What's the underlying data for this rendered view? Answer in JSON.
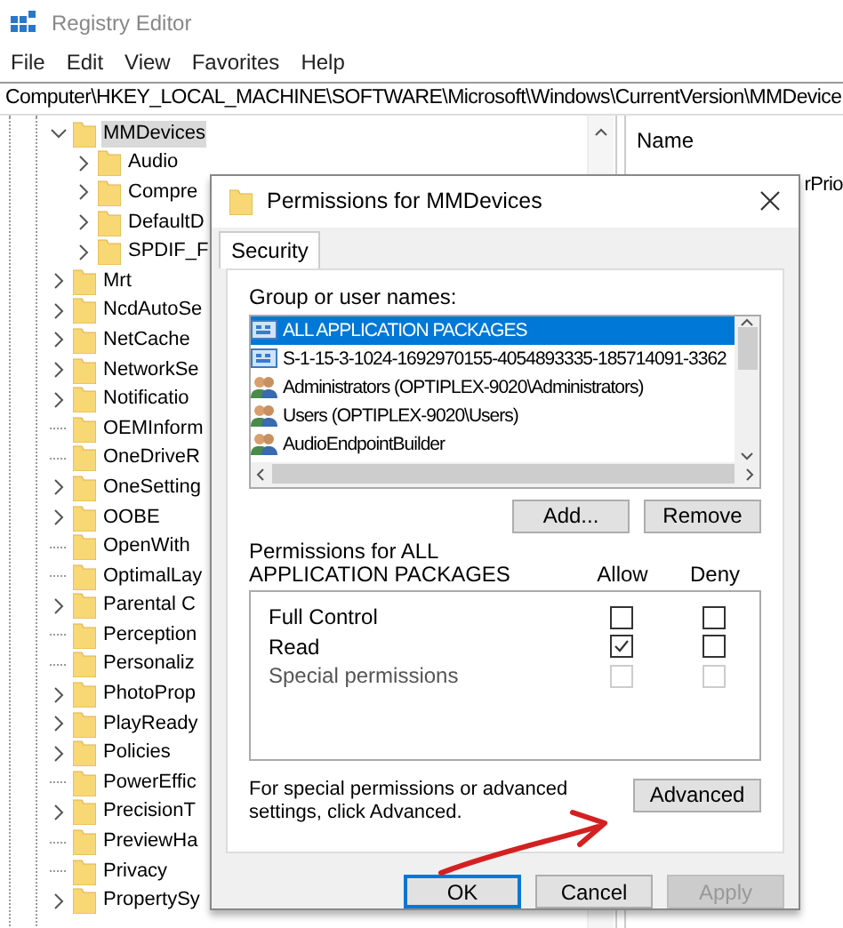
{
  "window": {
    "title": "Registry Editor"
  },
  "menu": [
    "File",
    "Edit",
    "View",
    "Favorites",
    "Help"
  ],
  "address": "Computer\\HKEY_LOCAL_MACHINE\\SOFTWARE\\Microsoft\\Windows\\CurrentVersion\\MMDevice",
  "tree": [
    {
      "label": "MMDevices",
      "expandable": true,
      "expanded": true,
      "selected": true,
      "children": [
        {
          "label": "Audio",
          "expandable": true,
          "expanded": false,
          "selected": false
        },
        {
          "label": "Compre",
          "expandable": true,
          "expanded": false,
          "selected": false
        },
        {
          "label": "DefaultD",
          "expandable": true,
          "expanded": false,
          "selected": false
        },
        {
          "label": "SPDIF_F",
          "expandable": true,
          "expanded": false,
          "selected": false
        }
      ]
    },
    {
      "label": "Mrt",
      "expandable": true,
      "expanded": false,
      "selected": false
    },
    {
      "label": "NcdAutoSe",
      "expandable": true,
      "expanded": false,
      "selected": false
    },
    {
      "label": "NetCache",
      "expandable": true,
      "expanded": false,
      "selected": false
    },
    {
      "label": "NetworkSe",
      "expandable": true,
      "expanded": false,
      "selected": false
    },
    {
      "label": "Notificatio",
      "expandable": true,
      "expanded": false,
      "selected": false
    },
    {
      "label": "OEMInform",
      "expandable": false,
      "selected": false
    },
    {
      "label": "OneDriveR",
      "expandable": false,
      "selected": false
    },
    {
      "label": "OneSetting",
      "expandable": true,
      "expanded": false,
      "selected": false
    },
    {
      "label": "OOBE",
      "expandable": true,
      "expanded": false,
      "selected": false
    },
    {
      "label": "OpenWith",
      "expandable": false,
      "selected": false
    },
    {
      "label": "OptimalLay",
      "expandable": false,
      "selected": false
    },
    {
      "label": "Parental C",
      "expandable": true,
      "expanded": false,
      "selected": false
    },
    {
      "label": "Perception",
      "expandable": false,
      "selected": false
    },
    {
      "label": "Personaliz",
      "expandable": false,
      "selected": false
    },
    {
      "label": "PhotoProp",
      "expandable": true,
      "expanded": false,
      "selected": false
    },
    {
      "label": "PlayReady",
      "expandable": true,
      "expanded": false,
      "selected": false
    },
    {
      "label": "Policies",
      "expandable": true,
      "expanded": false,
      "selected": false
    },
    {
      "label": "PowerEffic",
      "expandable": false,
      "selected": false
    },
    {
      "label": "PrecisionT",
      "expandable": true,
      "expanded": false,
      "selected": false
    },
    {
      "label": "PreviewHa",
      "expandable": false,
      "selected": false
    },
    {
      "label": "Privacy",
      "expandable": false,
      "selected": false
    },
    {
      "label": "PropertySy",
      "expandable": true,
      "expanded": false,
      "selected": false
    }
  ],
  "values_pane": {
    "column": "Name",
    "value_fragment": "rPrio"
  },
  "dialog": {
    "title": "Permissions for MMDevices",
    "tabs": [
      {
        "label": "Security",
        "selected": true
      }
    ],
    "group_label": "Group or user names:",
    "groups": [
      {
        "name": "ALL APPLICATION PACKAGES",
        "kind": "package",
        "selected": true
      },
      {
        "name": "S-1-15-3-1024-1692970155-4054893335-185714091-3362",
        "kind": "package",
        "selected": false
      },
      {
        "name": "Administrators (OPTIPLEX-9020\\Administrators)",
        "kind": "user",
        "selected": false
      },
      {
        "name": "Users (OPTIPLEX-9020\\Users)",
        "kind": "user",
        "selected": false
      },
      {
        "name": "AudioEndpointBuilder",
        "kind": "user",
        "selected": false
      }
    ],
    "group_buttons": [
      "Add...",
      "Remove"
    ],
    "permissions_label": "Permissions for ALL APPLICATION PACKAGES",
    "allow_header": "Allow",
    "deny_header": "Deny",
    "permissions": [
      {
        "name": "Full Control",
        "allow": false,
        "deny": false,
        "disabled": false
      },
      {
        "name": "Read",
        "allow": true,
        "deny": false,
        "disabled": false
      },
      {
        "name": "Special permissions",
        "allow": false,
        "deny": false,
        "disabled": true
      }
    ],
    "advanced_note": "For special permissions or advanced settings, click Advanced.",
    "advanced_button": "Advanced",
    "buttons": [
      {
        "label": "OK",
        "default": true,
        "disabled": false
      },
      {
        "label": "Cancel",
        "default": false,
        "disabled": false
      },
      {
        "label": "Apply",
        "default": false,
        "disabled": true
      }
    ]
  }
}
